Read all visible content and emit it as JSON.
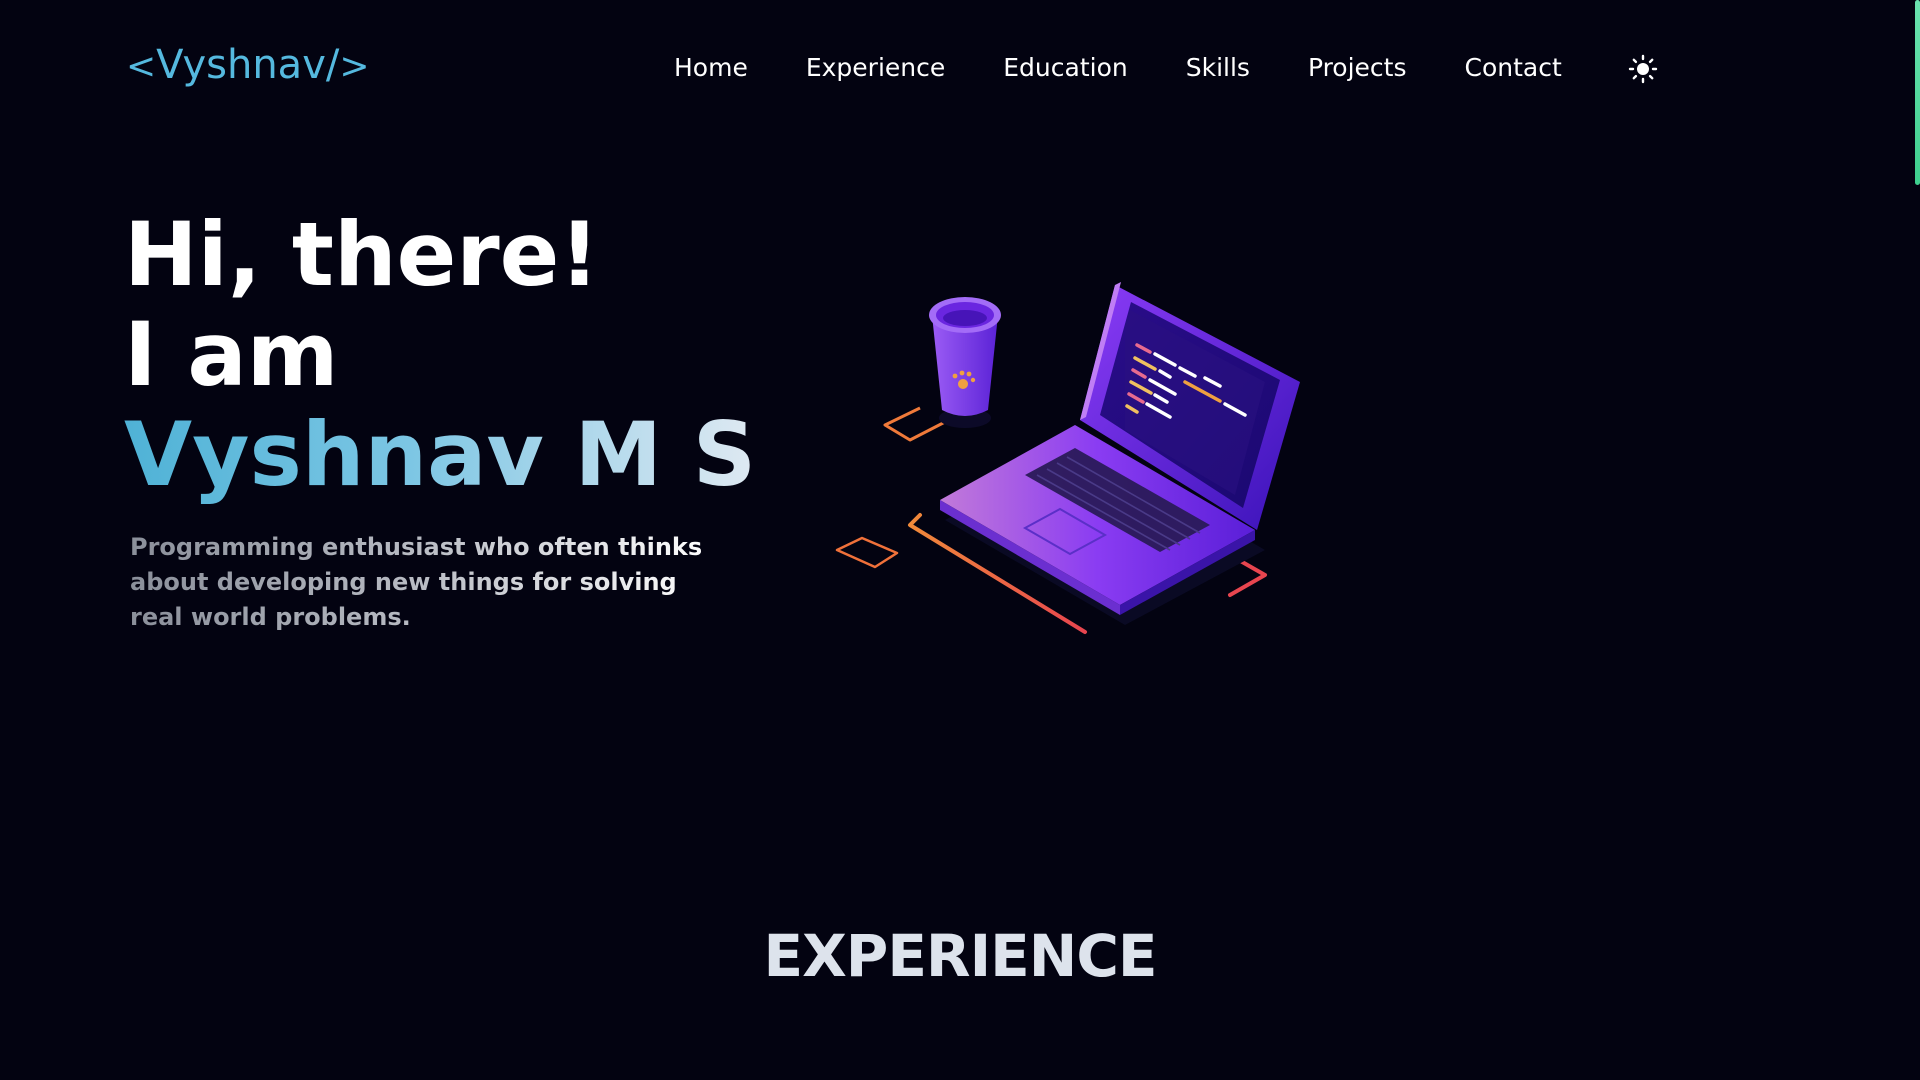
{
  "brand": {
    "open_tag": "<",
    "name": "Vyshnav/",
    "close_tag": ">"
  },
  "nav": {
    "items": [
      {
        "label": "Home"
      },
      {
        "label": "Experience"
      },
      {
        "label": "Education"
      },
      {
        "label": "Skills"
      },
      {
        "label": "Projects"
      },
      {
        "label": "Contact"
      }
    ],
    "theme_toggle_icon": "sun-icon"
  },
  "hero": {
    "greeting": "Hi, there!",
    "intro": "I am",
    "name": "Vyshnav M S",
    "tagline": "Programming enthusiast who often thinks about developing new things for solving real world problems.",
    "illustration_icon": "laptop-coffee-illustration"
  },
  "experience": {
    "title": "EXPERIENCE"
  },
  "colors": {
    "background": "#030311",
    "accent_blue": "#55b9df",
    "scroll_accent": "#3ecf8e",
    "illustration_purple": "#7b2ff7",
    "illustration_orange": "#f07a3a"
  },
  "scroll": {
    "progress": 0.0
  }
}
